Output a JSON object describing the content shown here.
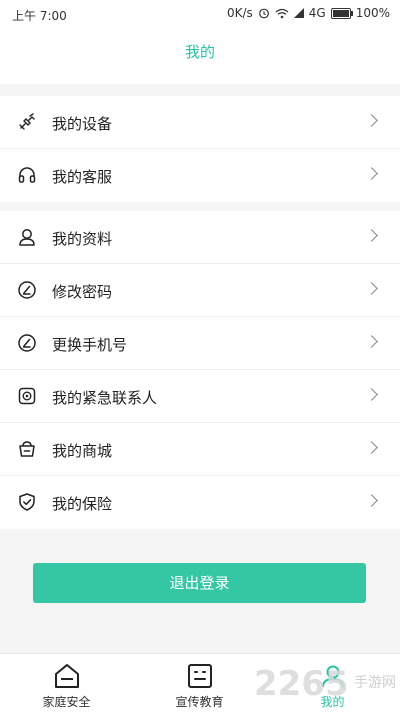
{
  "status_bar": {
    "time": "上午 7:00",
    "network_speed": "0K/s",
    "signal": "4G",
    "battery": "100%"
  },
  "header": {
    "title": "我的"
  },
  "groups": [
    {
      "items": [
        {
          "icon": "device-icon",
          "label": "我的设备"
        },
        {
          "icon": "headset-icon",
          "label": "我的客服"
        }
      ]
    },
    {
      "items": [
        {
          "icon": "profile-icon",
          "label": "我的资料"
        },
        {
          "icon": "edit-password-icon",
          "label": "修改密码"
        },
        {
          "icon": "edit-phone-icon",
          "label": "更换手机号"
        },
        {
          "icon": "emergency-contact-icon",
          "label": "我的紧急联系人"
        },
        {
          "icon": "shop-basket-icon",
          "label": "我的商城"
        },
        {
          "icon": "shield-icon",
          "label": "我的保险"
        }
      ]
    }
  ],
  "logout_label": "退出登录",
  "tabs": [
    {
      "icon": "home-icon",
      "label": "家庭安全",
      "active": false
    },
    {
      "icon": "tv-icon",
      "label": "宣传教育",
      "active": false
    },
    {
      "icon": "person-icon",
      "label": "我的",
      "active": true
    }
  ],
  "watermark": {
    "number": "2265",
    "text": "手游网"
  },
  "colors": {
    "accent": "#28c3a4",
    "button": "#35c6a4",
    "background": "#f5f5f5"
  }
}
